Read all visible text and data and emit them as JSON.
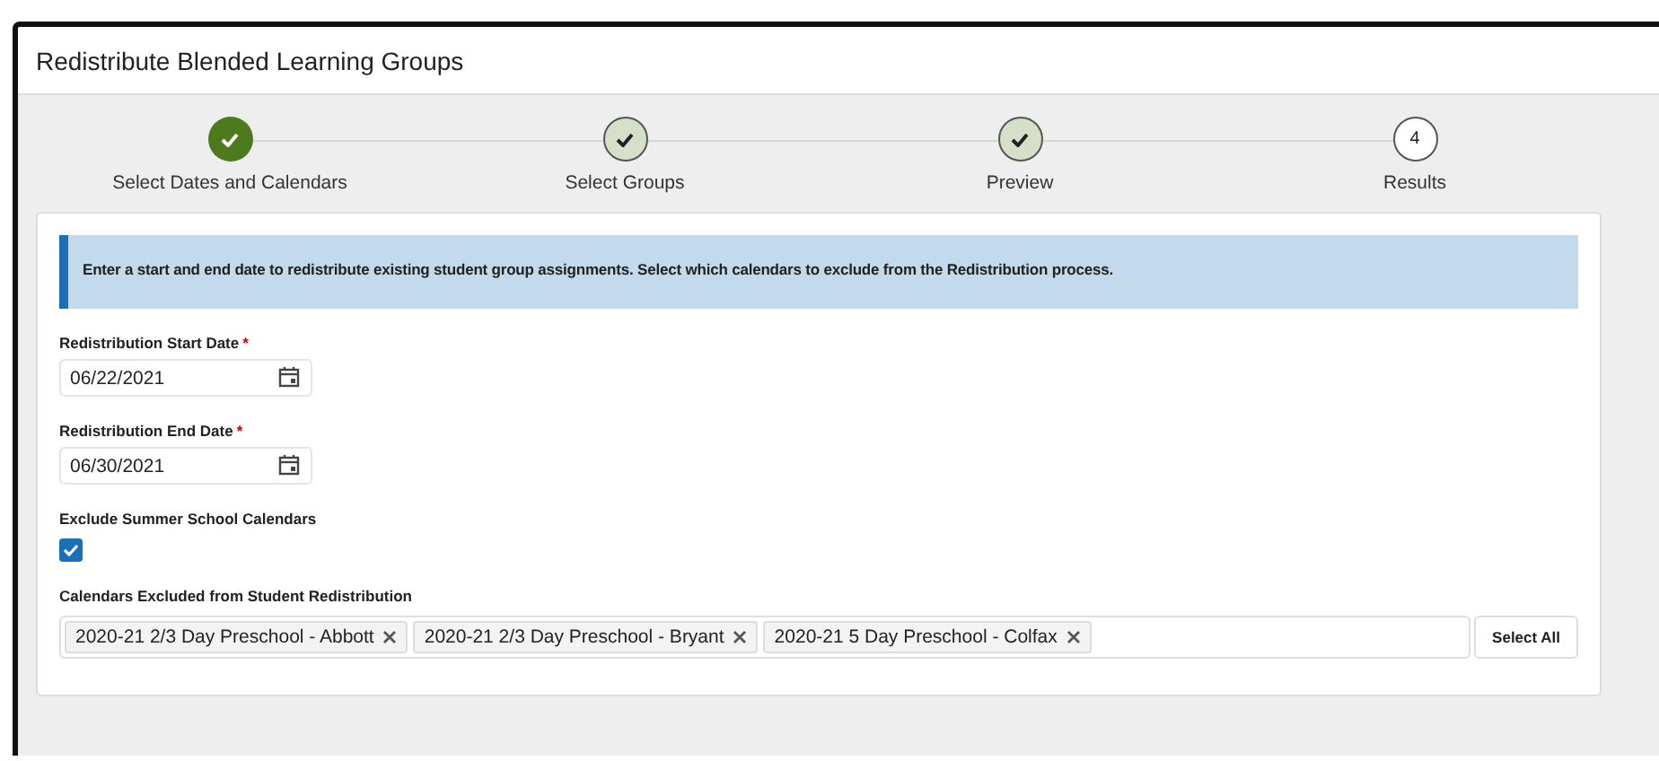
{
  "window": {
    "title": "Redistribute Blended Learning Groups"
  },
  "steps": [
    {
      "label": "Select Dates and Calendars",
      "done": true,
      "selected": true
    },
    {
      "label": "Select Groups",
      "done": true,
      "selected": false
    },
    {
      "label": "Preview",
      "done": true,
      "selected": false
    },
    {
      "label": "Results",
      "done": false,
      "selected": false,
      "number": "4"
    }
  ],
  "info": "Enter a start and end date to redistribute existing student group assignments. Select which calendars to exclude from the Redistribution process.",
  "fields": [
    {
      "kind": "date",
      "label": "Redistribution Start Date",
      "required_mark": "*",
      "value": "06/22/2021"
    },
    {
      "kind": "date",
      "label": "Redistribution End Date",
      "required_mark": "*",
      "value": "06/30/2021"
    },
    {
      "kind": "checkbox",
      "label": "Exclude Summer School Calendars",
      "checked": true
    },
    {
      "kind": "tags",
      "label": "Calendars Excluded from Student Redistribution",
      "tags": [
        "2020-21 2/3 Day Preschool - Abbott",
        "2020-21 2/3 Day Preschool - Bryant",
        "2020-21 5 Day Preschool - Colfax"
      ],
      "button": "Select All"
    }
  ]
}
